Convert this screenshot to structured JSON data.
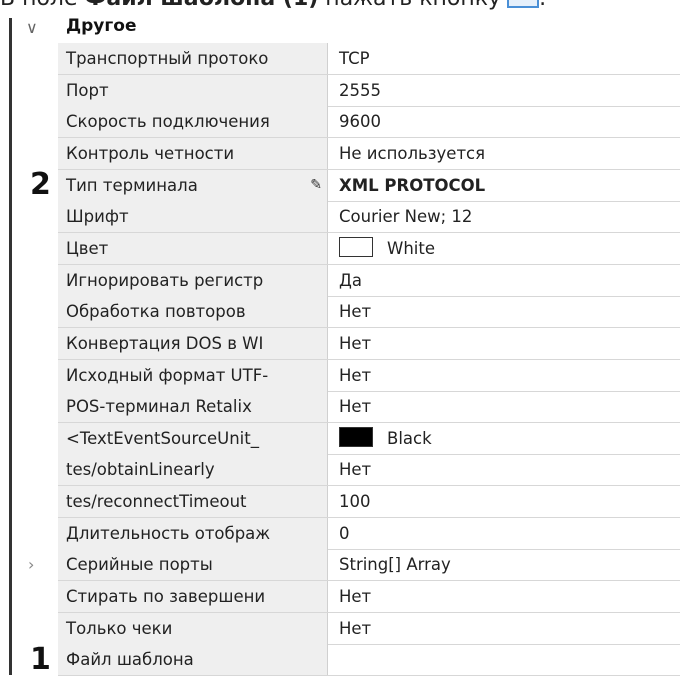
{
  "instruction": {
    "prefix": "В поле ",
    "field": "Файл шаблона",
    "marker": " (1)",
    "suffix": " нажать кнопку",
    "end": "."
  },
  "group": {
    "title": "Другое",
    "icon": "chevron-down-icon"
  },
  "markers": {
    "m2": "2",
    "m1": "1"
  },
  "colors": {
    "white": "#ffffff",
    "black": "#000000"
  },
  "rows": [
    {
      "name": "Транспортный протоко",
      "value": "TCP"
    },
    {
      "name": "Порт",
      "value": "2555"
    },
    {
      "name": "Скорость подключения",
      "value": "9600"
    },
    {
      "name": "Контроль четности",
      "value": "Не используется"
    },
    {
      "name": "Тип терминала",
      "value": "XML PROTOCOL"
    },
    {
      "name": "Шрифт",
      "value": "Courier New; 12"
    },
    {
      "name": "Цвет",
      "value": "White"
    },
    {
      "name": "Игнорировать регистр",
      "value": "Да"
    },
    {
      "name": "Обработка повторов",
      "value": "Нет"
    },
    {
      "name": "Конвертация DOS в WI",
      "value": "Нет"
    },
    {
      "name": "Исходный формат UTF-",
      "value": "Нет"
    },
    {
      "name": "POS-терминал Retalix",
      "value": "Нет"
    },
    {
      "name": "<TextEventSourceUnit_",
      "value": "Black"
    },
    {
      "name": "tes/obtainLinearly",
      "value": "Нет"
    },
    {
      "name": "tes/reconnectTimeout",
      "value": "100"
    },
    {
      "name": "Длительность отображ",
      "value": "0"
    },
    {
      "name": "Серийные порты",
      "value": "String[] Array"
    },
    {
      "name": "Стирать по завершени",
      "value": "Нет"
    },
    {
      "name": "Только чеки",
      "value": "Нет"
    },
    {
      "name": "Файл шаблона",
      "value": ""
    }
  ]
}
